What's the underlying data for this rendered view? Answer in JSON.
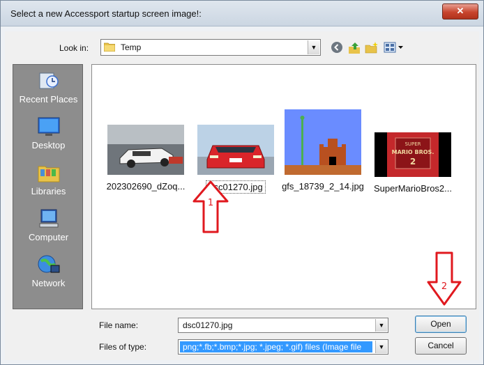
{
  "dialog": {
    "title": "Select a new Accessport startup screen image!:",
    "close_glyph": "✕"
  },
  "lookin": {
    "label": "Look in:",
    "value": "Temp"
  },
  "toolbar": {
    "icons": [
      "back-icon",
      "up-folder-icon",
      "new-folder-icon",
      "view-menu-icon"
    ]
  },
  "places": [
    {
      "label": "Recent Places",
      "icon": "recent-places-icon"
    },
    {
      "label": "Desktop",
      "icon": "desktop-icon"
    },
    {
      "label": "Libraries",
      "icon": "libraries-icon"
    },
    {
      "label": "Computer",
      "icon": "computer-icon"
    },
    {
      "label": "Network",
      "icon": "network-icon"
    }
  ],
  "files": [
    {
      "name": "202302690_dZoq...",
      "selected": false
    },
    {
      "name": "dsc01270.jpg",
      "selected": true
    },
    {
      "name": "gfs_18739_2_14.jpg",
      "selected": false
    },
    {
      "name": "SuperMarioBros2...",
      "selected": false
    }
  ],
  "thumb_text": {
    "smb2_line1": "SUPER",
    "smb2_line2": "MARIO BROS.",
    "smb2_line3": "2"
  },
  "filename": {
    "label": "File name:",
    "value": "dsc01270.jpg"
  },
  "filetype": {
    "label": "Files of type:",
    "value": "png;*.fb;*.bmp;*.jpg; *.jpeg; *.gif) files (Image file"
  },
  "buttons": {
    "open": "Open",
    "cancel": "Cancel"
  },
  "annotations": {
    "arrow1_number": "1",
    "arrow2_number": "2",
    "arrow_color": "#e0191f"
  }
}
